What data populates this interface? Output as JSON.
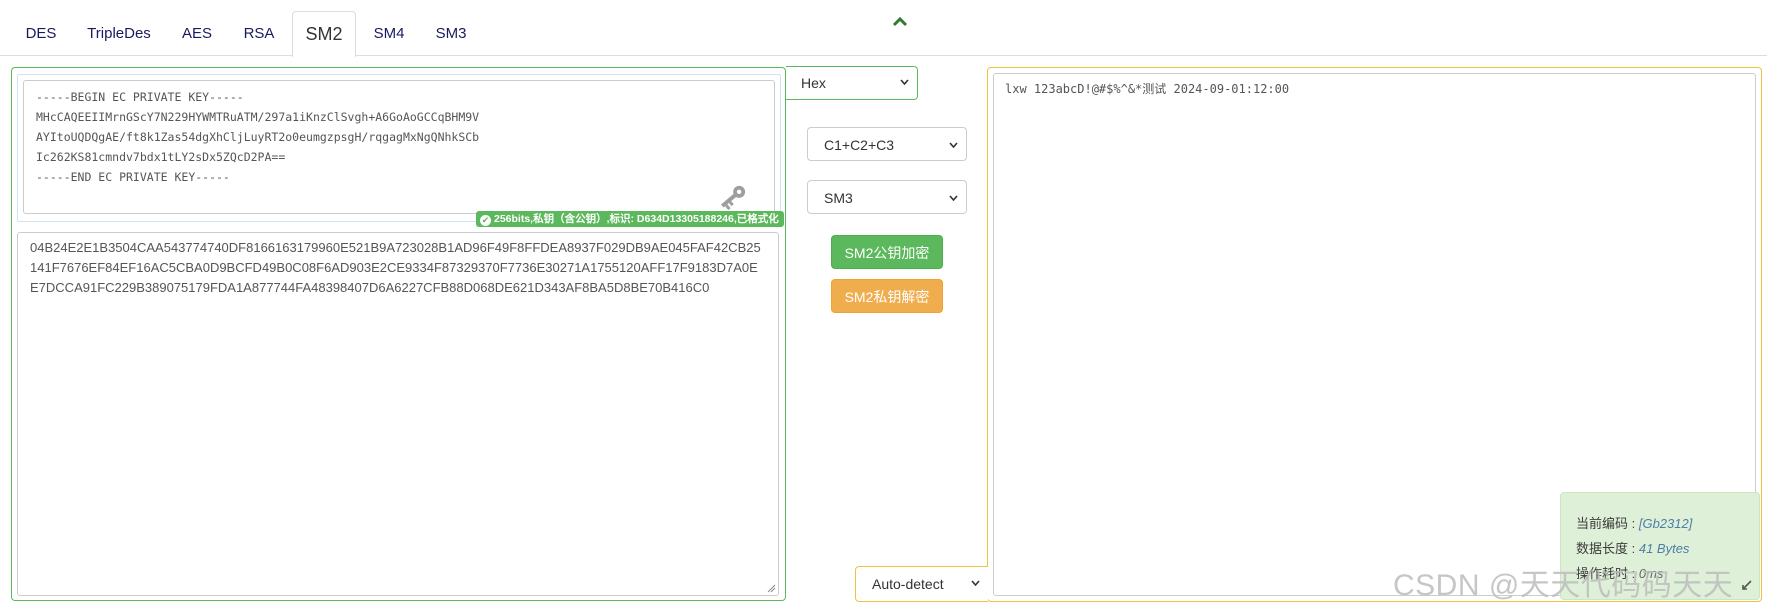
{
  "tabs": [
    {
      "label": "DES"
    },
    {
      "label": "TripleDes"
    },
    {
      "label": "AES"
    },
    {
      "label": "RSA"
    },
    {
      "label": "SM2"
    },
    {
      "label": "SM4"
    },
    {
      "label": "SM3"
    }
  ],
  "active_tab": "SM2",
  "key": {
    "text": "-----BEGIN EC PRIVATE KEY-----\nMHcCAQEEIIMrnGScY7N229HYWMTRuATM/297a1iKnzClSvgh+A6GoAoGCCqBHM9V\nAYItoUQDQgAE/ft8k1Zas54dgXhCljLuyRT2o0eumgzpsgH/rqgagMxNgQNhkSCb\nIc262KS81cmndv7bdx1tLY2sDx5ZQcD2PA==\n-----END EC PRIVATE KEY-----",
    "badge": "256bits,私钥（含公钥）,标识: D634D13305188246,已格式化"
  },
  "ciphertext": "04B24E2E1B3504CAA543774740DF8166163179960E521B9A723028B1AD96F49F8FFDEA8937F029DB9AE045FAF42CB25141F7676EF84EF16AC5CBA0D9BCFD49B0C08F6AD903E2CE9334F87329370F7736E30271A1755120AFF17F9183D7A0EE7DCCA91FC229B389075179FDA1A877744FA48398407D6A6227CFB88D068DE621D343AF8BA5D8BE70B416C0",
  "controls": {
    "output_format": "Hex",
    "cipher_mode": "C1+C2+C3",
    "hash": "SM3",
    "encrypt_label": "SM2公钥加密",
    "decrypt_label": "SM2私钥解密"
  },
  "plaintext": "lxw 123abcD!@#$%^&*测试 2024-09-01:12:00",
  "encoding_select": "Auto-detect",
  "info": {
    "encoding_label": "当前编码 : ",
    "encoding_value": "[Gb2312]",
    "length_label": "数据长度 : ",
    "length_value": "41 Bytes",
    "time_label": "操作耗时 : ",
    "time_value": "0ms"
  },
  "watermark": "CSDN @天天代码码天天",
  "colors": {
    "success": "#5cb85c",
    "warning": "#f0ad4e",
    "panel_right_border": "#f0c040"
  }
}
